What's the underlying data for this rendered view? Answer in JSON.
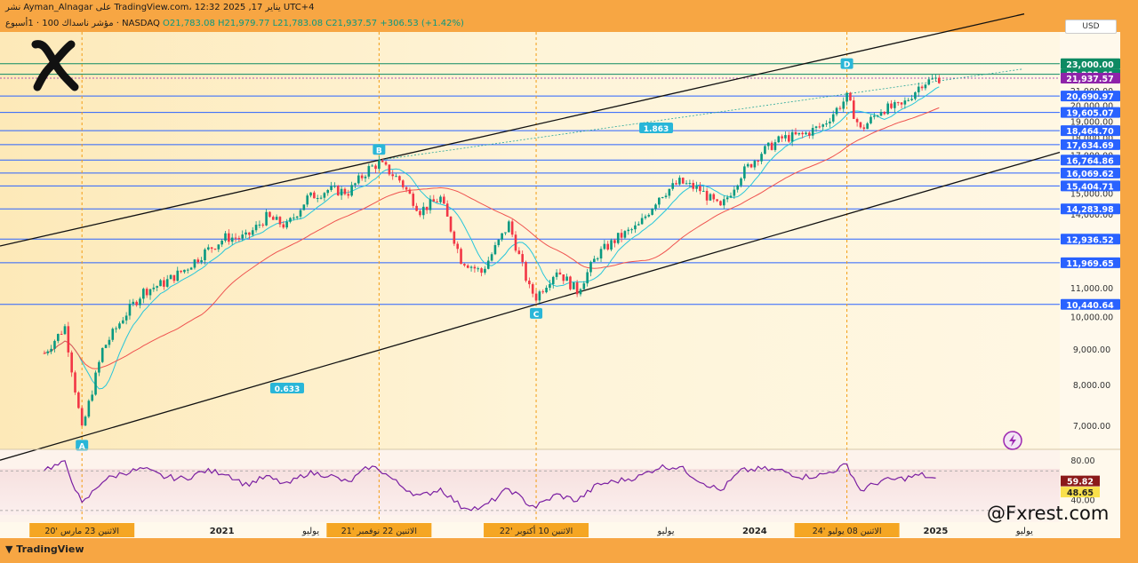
{
  "header": {
    "headline": "نشر Ayman_Alnagar على TradingView.com، يناير 17, 2025 12:32 UTC+4",
    "instrument": "مؤشر ناسداك 100 · 1أسبوع · NASDAQ",
    "open": "O21,783.08",
    "high": "H21,979.77",
    "low": "L21,783.08",
    "close": "C21,937.57",
    "change": "+306.53 (+1.42%)"
  },
  "currency": "USD",
  "footer": {
    "brand": "TradingView",
    "watermark": "@Fxrest.com"
  },
  "colors": {
    "bull": "#089981",
    "bear": "#f23645",
    "ma_fast": "#26c6da",
    "ma_slow": "#ef5350",
    "level_line": "#2962ff",
    "channel": "#111111",
    "highlight": "#ffd36b",
    "rsi": "#7b1fa2"
  },
  "chart_data": [
    {
      "type": "line",
      "title": "",
      "y_axis": {
        "ticks": [
          "7,000.00",
          "8,000.00",
          "9,000.00",
          "10,000.00",
          "11,000.00",
          "12,000.00",
          "13,000.00",
          "14,000.00",
          "15,000.00",
          "16,000.00",
          "17,000.00",
          "18,000.00",
          "19,000.00",
          "20,000.00",
          "21,000.00"
        ],
        "scale": "log"
      },
      "x_axis": {
        "labels": [
          "2021",
          "يوليو",
          "يوليو",
          "2024",
          "2025",
          "يوليو"
        ],
        "highlighted_dates": [
          "الاثنين 23 مارس '20",
          "الاثنين 22 نوفمبر '21",
          "الاثنين 10 أكتوبر '22",
          "الاثنين 08 يوليو '24"
        ]
      },
      "price_levels": [
        {
          "label": "23,000.00",
          "value": 23000,
          "style": "box-green"
        },
        {
          "label": "22,222.61",
          "value": 22222.61,
          "style": "box-green"
        },
        {
          "label": "21,937.57",
          "value": 21937.57,
          "style": "box-purple"
        },
        {
          "label": "20,690.97",
          "value": 20690.97,
          "style": "box-blue"
        },
        {
          "label": "19,605.07",
          "value": 19605.07,
          "style": "box-blue"
        },
        {
          "label": "18,464.70",
          "value": 18464.7,
          "style": "box-blue"
        },
        {
          "label": "17,634.69",
          "value": 17634.69,
          "style": "box-blue"
        },
        {
          "label": "16,764.86",
          "value": 16764.86,
          "style": "box-blue"
        },
        {
          "label": "16,069.62",
          "value": 16069.62,
          "style": "box-blue"
        },
        {
          "label": "15,404.71",
          "value": 15404.71,
          "style": "box-blue"
        },
        {
          "label": "14,283.98",
          "value": 14283.98,
          "style": "box-blue"
        },
        {
          "label": "12,936.52",
          "value": 12936.52,
          "style": "box-blue"
        },
        {
          "label": "11,969.65",
          "value": 11969.65,
          "style": "box-blue"
        },
        {
          "label": "10,440.64",
          "value": 10440.64,
          "style": "box-blue"
        }
      ],
      "pivots": [
        {
          "label": "A",
          "x": "2020-03-23",
          "y": 6771
        },
        {
          "label": "B",
          "x": "2021-11-22",
          "y": 16764
        },
        {
          "label": "C",
          "x": "2022-10-10",
          "y": 10440
        },
        {
          "label": "D",
          "x": "2024-07-08",
          "y": 22222
        }
      ],
      "fib_labels": [
        {
          "label": "1.863"
        },
        {
          "label": "0.633"
        }
      ],
      "series": [
        {
          "values": [
            {
              "x": "2020-01-06",
              "y": 8900
            },
            {
              "x": "2020-02-17",
              "y": 9700
            },
            {
              "x": "2020-03-23",
              "y": 6900
            },
            {
              "x": "2020-05-04",
              "y": 9000
            },
            {
              "x": "2020-06-15",
              "y": 10000
            },
            {
              "x": "2020-07-27",
              "y": 10900
            },
            {
              "x": "2020-09-07",
              "y": 11200
            },
            {
              "x": "2020-10-19",
              "y": 11700
            },
            {
              "x": "2020-11-30",
              "y": 12400
            },
            {
              "x": "2021-01-11",
              "y": 13000
            },
            {
              "x": "2021-02-22",
              "y": 13000
            },
            {
              "x": "2021-04-05",
              "y": 13900
            },
            {
              "x": "2021-05-17",
              "y": 13500
            },
            {
              "x": "2021-06-28",
              "y": 14800
            },
            {
              "x": "2021-08-09",
              "y": 15200
            },
            {
              "x": "2021-09-20",
              "y": 15100
            },
            {
              "x": "2021-11-01",
              "y": 16300
            },
            {
              "x": "2021-11-22",
              "y": 16600
            },
            {
              "x": "2022-01-03",
              "y": 15700
            },
            {
              "x": "2022-02-14",
              "y": 14200
            },
            {
              "x": "2022-03-28",
              "y": 14800
            },
            {
              "x": "2022-05-09",
              "y": 12100
            },
            {
              "x": "2022-06-20",
              "y": 11600
            },
            {
              "x": "2022-08-15",
              "y": 13600
            },
            {
              "x": "2022-09-26",
              "y": 11000
            },
            {
              "x": "2022-10-10",
              "y": 10700
            },
            {
              "x": "2022-11-21",
              "y": 11700
            },
            {
              "x": "2023-01-02",
              "y": 10900
            },
            {
              "x": "2023-02-13",
              "y": 12300
            },
            {
              "x": "2023-03-27",
              "y": 13000
            },
            {
              "x": "2023-05-08",
              "y": 13500
            },
            {
              "x": "2023-06-19",
              "y": 14900
            },
            {
              "x": "2023-07-31",
              "y": 15600
            },
            {
              "x": "2023-09-11",
              "y": 15200
            },
            {
              "x": "2023-10-23",
              "y": 14300
            },
            {
              "x": "2023-12-04",
              "y": 16000
            },
            {
              "x": "2024-01-15",
              "y": 17200
            },
            {
              "x": "2024-02-26",
              "y": 18000
            },
            {
              "x": "2024-04-08",
              "y": 18200
            },
            {
              "x": "2024-05-20",
              "y": 18800
            },
            {
              "x": "2024-07-08",
              "y": 20600
            },
            {
              "x": "2024-08-05",
              "y": 18500
            },
            {
              "x": "2024-09-16",
              "y": 19800
            },
            {
              "x": "2024-10-28",
              "y": 20000
            },
            {
              "x": "2024-12-09",
              "y": 21600
            },
            {
              "x": "2025-01-13",
              "y": 21937.57
            }
          ]
        }
      ]
    },
    {
      "type": "line",
      "title": "",
      "y_axis": {
        "ticks": [
          "80.00",
          "40.00"
        ],
        "ylim": [
          20,
          90
        ]
      },
      "levels": [
        {
          "label": "59.82",
          "value": 59.82
        },
        {
          "label": "48.65",
          "value": 48.65
        }
      ],
      "series": [
        {
          "values": [
            {
              "x": "2020-01-06",
              "y": 72
            },
            {
              "x": "2020-02-17",
              "y": 78
            },
            {
              "x": "2020-03-23",
              "y": 36
            },
            {
              "x": "2020-05-04",
              "y": 60
            },
            {
              "x": "2020-06-15",
              "y": 68
            },
            {
              "x": "2020-07-27",
              "y": 72
            },
            {
              "x": "2020-09-07",
              "y": 64
            },
            {
              "x": "2020-10-19",
              "y": 62
            },
            {
              "x": "2020-11-30",
              "y": 70
            },
            {
              "x": "2021-01-11",
              "y": 68
            },
            {
              "x": "2021-02-22",
              "y": 56
            },
            {
              "x": "2021-04-05",
              "y": 64
            },
            {
              "x": "2021-05-17",
              "y": 56
            },
            {
              "x": "2021-06-28",
              "y": 68
            },
            {
              "x": "2021-08-09",
              "y": 66
            },
            {
              "x": "2021-09-20",
              "y": 58
            },
            {
              "x": "2021-11-01",
              "y": 74
            },
            {
              "x": "2021-11-22",
              "y": 72
            },
            {
              "x": "2022-01-03",
              "y": 56
            },
            {
              "x": "2022-02-14",
              "y": 44
            },
            {
              "x": "2022-03-28",
              "y": 52
            },
            {
              "x": "2022-05-09",
              "y": 34
            },
            {
              "x": "2022-06-20",
              "y": 32
            },
            {
              "x": "2022-08-15",
              "y": 52
            },
            {
              "x": "2022-09-26",
              "y": 36
            },
            {
              "x": "2022-10-10",
              "y": 34
            },
            {
              "x": "2022-11-21",
              "y": 46
            },
            {
              "x": "2023-01-02",
              "y": 40
            },
            {
              "x": "2023-02-13",
              "y": 56
            },
            {
              "x": "2023-03-27",
              "y": 60
            },
            {
              "x": "2023-05-08",
              "y": 64
            },
            {
              "x": "2023-06-19",
              "y": 74
            },
            {
              "x": "2023-07-31",
              "y": 74
            },
            {
              "x": "2023-09-11",
              "y": 60
            },
            {
              "x": "2023-10-23",
              "y": 50
            },
            {
              "x": "2023-12-04",
              "y": 70
            },
            {
              "x": "2024-01-15",
              "y": 72
            },
            {
              "x": "2024-02-26",
              "y": 70
            },
            {
              "x": "2024-04-08",
              "y": 64
            },
            {
              "x": "2024-05-20",
              "y": 66
            },
            {
              "x": "2024-07-08",
              "y": 76
            },
            {
              "x": "2024-08-05",
              "y": 50
            },
            {
              "x": "2024-09-16",
              "y": 60
            },
            {
              "x": "2024-10-28",
              "y": 62
            },
            {
              "x": "2024-12-09",
              "y": 66
            },
            {
              "x": "2025-01-13",
              "y": 59.82
            }
          ]
        }
      ]
    }
  ]
}
